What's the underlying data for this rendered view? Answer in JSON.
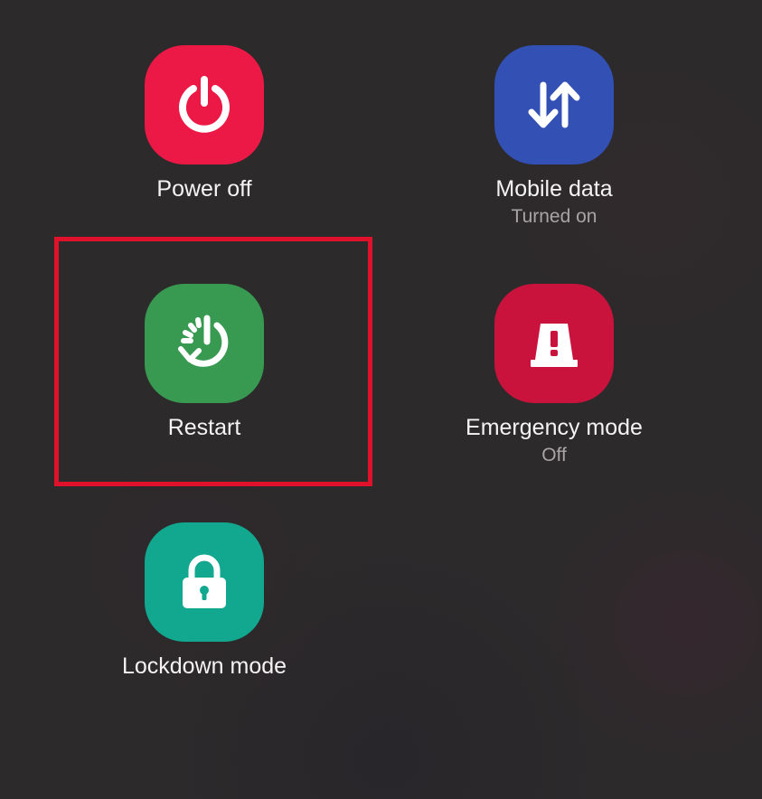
{
  "colors": {
    "power_off": "#ec1946",
    "mobile_data": "#3350b4",
    "restart": "#389a51",
    "emergency": "#c9133d",
    "lockdown": "#12a78f",
    "highlight_border": "#e0122b"
  },
  "menu": {
    "power_off": {
      "label": "Power off",
      "icon": "power-icon"
    },
    "mobile_data": {
      "label": "Mobile data",
      "status": "Turned on",
      "icon": "data-arrows-icon"
    },
    "restart": {
      "label": "Restart",
      "icon": "restart-icon"
    },
    "emergency_mode": {
      "label": "Emergency mode",
      "status": "Off",
      "icon": "emergency-light-icon"
    },
    "lockdown_mode": {
      "label": "Lockdown mode",
      "icon": "lock-icon"
    }
  }
}
